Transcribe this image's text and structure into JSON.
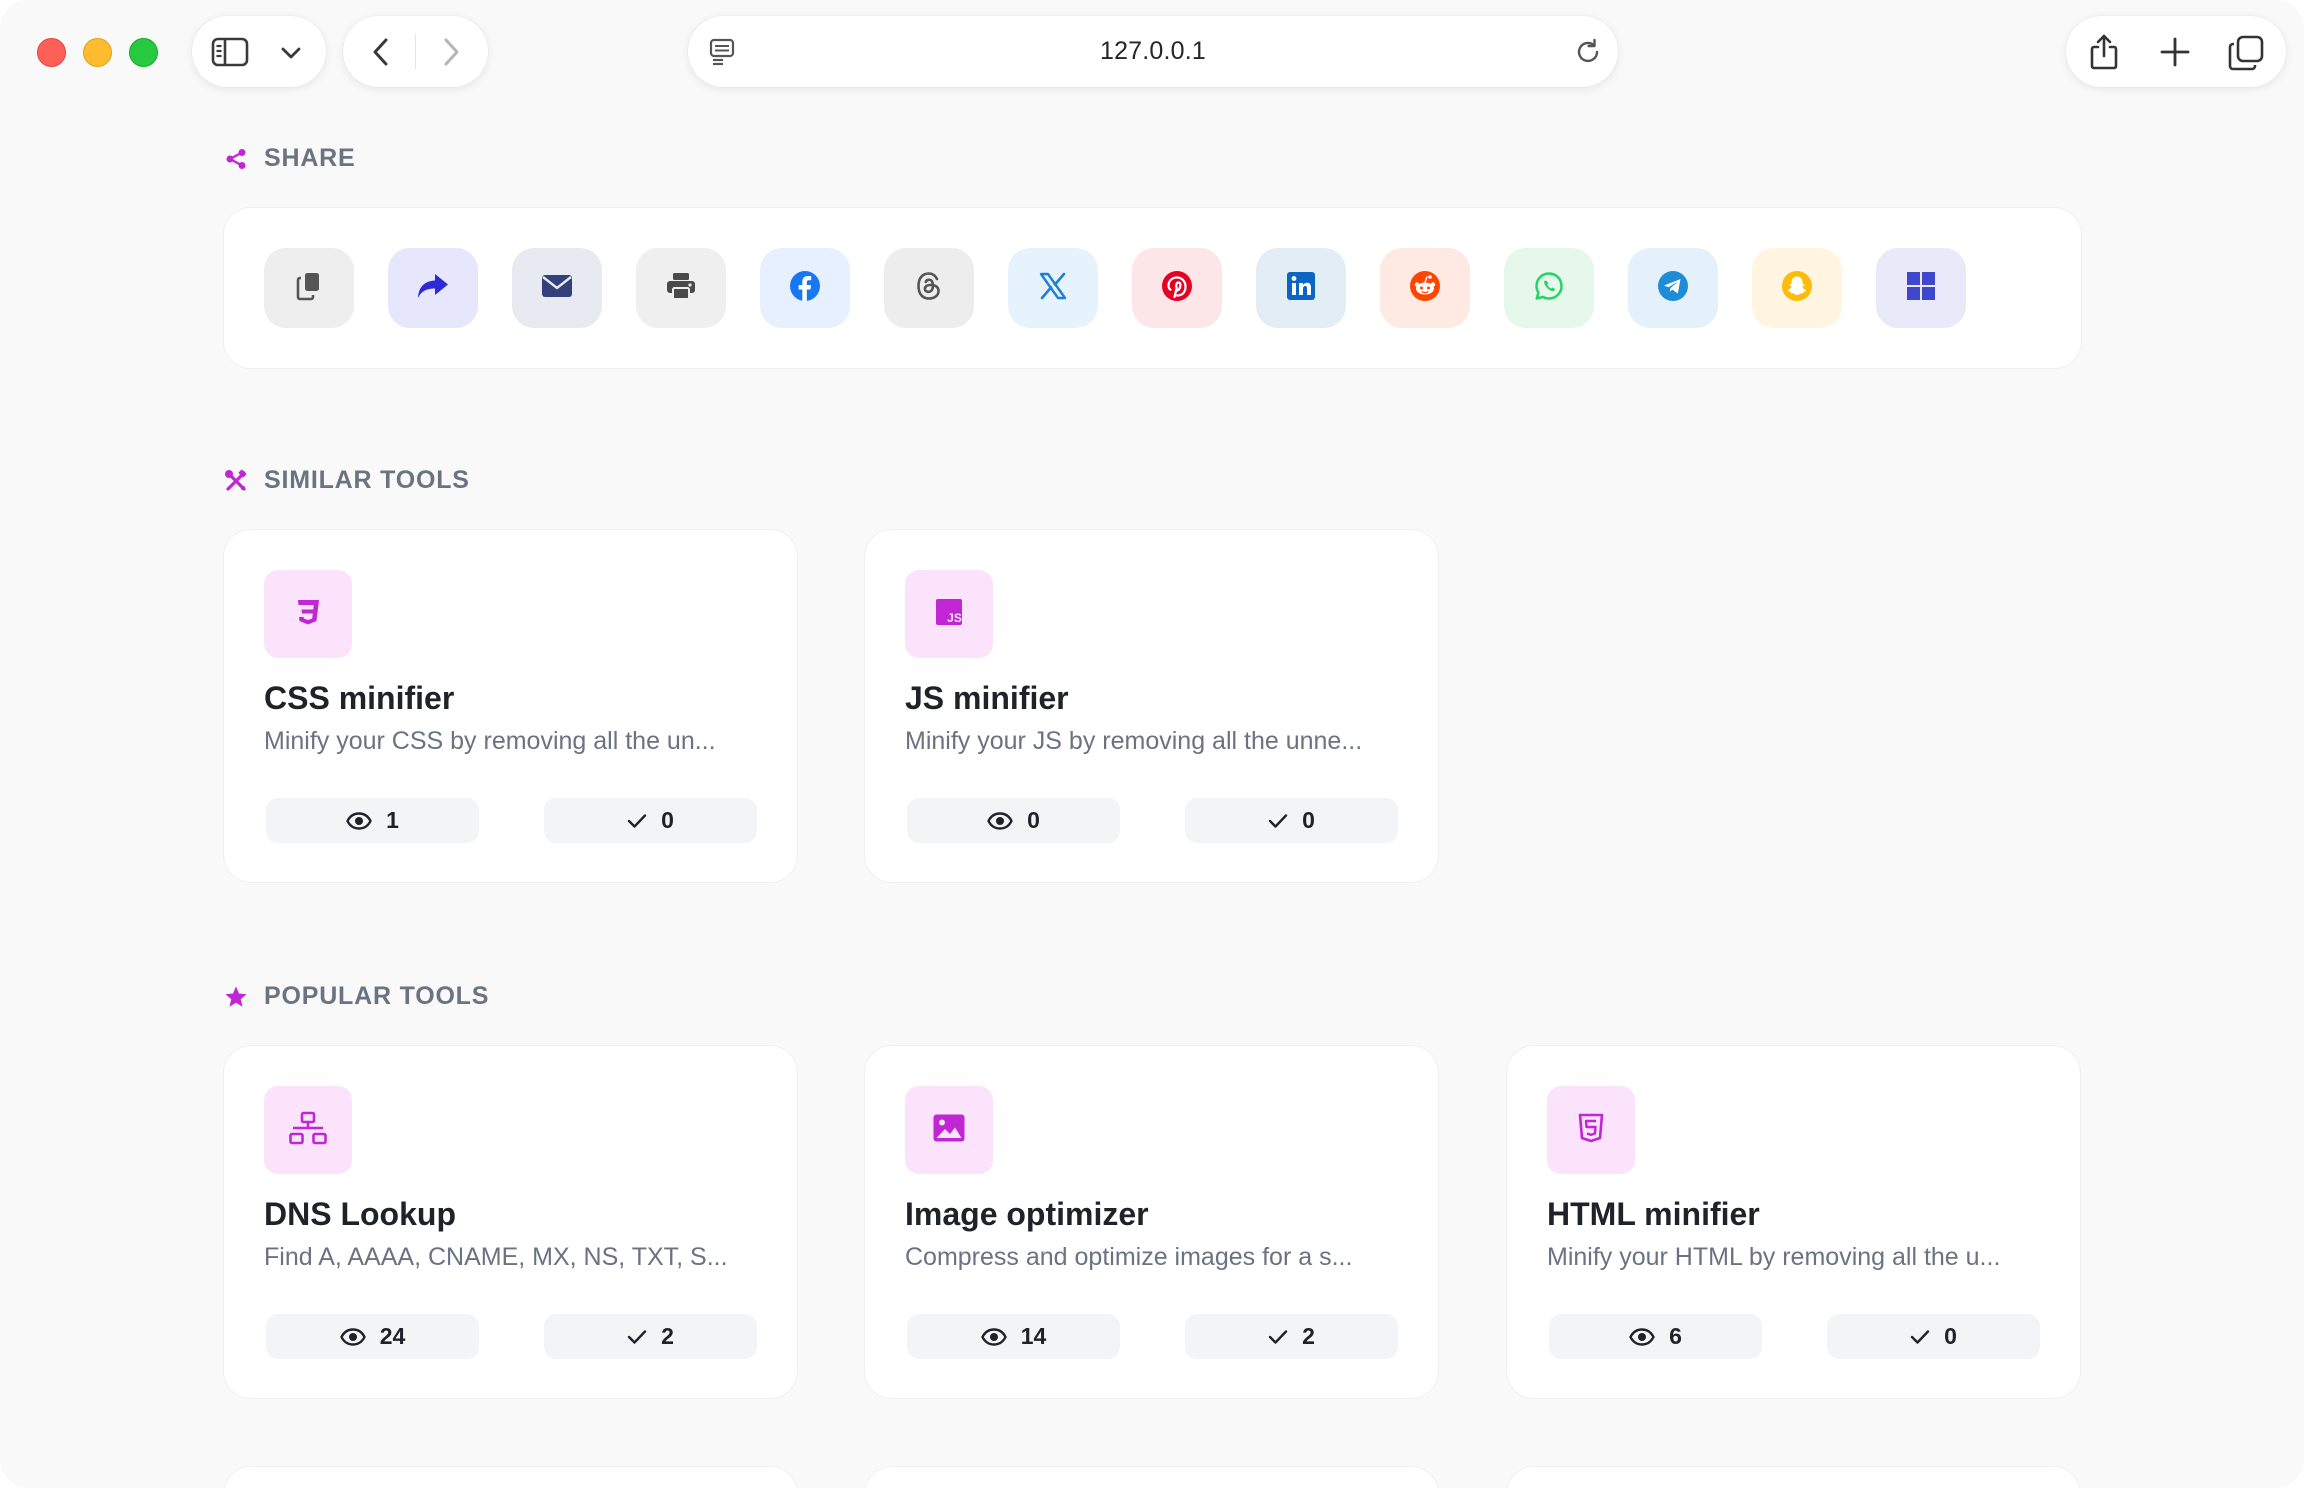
{
  "browser": {
    "url": "127.0.0.1"
  },
  "share": {
    "title": "SHARE",
    "buttons": [
      {
        "name": "copy-link",
        "icon": "copy-icon",
        "bg": "#eeeeef",
        "color": "#555555"
      },
      {
        "name": "native-share",
        "icon": "share-forward-icon",
        "bg": "#e6e7fd",
        "color": "#2b2ad6"
      },
      {
        "name": "email",
        "icon": "envelope-icon",
        "bg": "#e8eaf2",
        "color": "#33407a"
      },
      {
        "name": "print",
        "icon": "printer-icon",
        "bg": "#efeff0",
        "color": "#4a4a4a"
      },
      {
        "name": "facebook",
        "icon": "facebook-icon",
        "bg": "#e6f0fe",
        "color": "#1877f2"
      },
      {
        "name": "threads",
        "icon": "threads-icon",
        "bg": "#ededee",
        "color": "#555555"
      },
      {
        "name": "x",
        "icon": "x-icon",
        "bg": "#e6f3fd",
        "color": "#1d7fd6"
      },
      {
        "name": "pinterest",
        "icon": "pinterest-icon",
        "bg": "#fde6e8",
        "color": "#e60023"
      },
      {
        "name": "linkedin",
        "icon": "linkedin-icon",
        "bg": "#e3edf6",
        "color": "#0a66c2"
      },
      {
        "name": "reddit",
        "icon": "reddit-icon",
        "bg": "#feeae3",
        "color": "#ff4500"
      },
      {
        "name": "whatsapp",
        "icon": "whatsapp-icon",
        "bg": "#e6f8ec",
        "color": "#25d366"
      },
      {
        "name": "telegram",
        "icon": "telegram-icon",
        "bg": "#e4f1fb",
        "color": "#1f8dd6"
      },
      {
        "name": "snapchat",
        "icon": "snapchat-icon",
        "bg": "#fff5e1",
        "color": "#fcbc0c"
      },
      {
        "name": "microsoft",
        "icon": "windows-icon",
        "bg": "#e9e9fa",
        "color": "#3f48cc"
      }
    ]
  },
  "similar": {
    "title": "SIMILAR TOOLS",
    "tools": [
      {
        "title": "CSS minifier",
        "desc": "Minify your CSS by removing all the un...",
        "views": "1",
        "done": "0",
        "icon": "css3-icon"
      },
      {
        "title": "JS minifier",
        "desc": "Minify your JS by removing all the unne...",
        "views": "0",
        "done": "0",
        "icon": "js-icon"
      }
    ]
  },
  "popular": {
    "title": "POPULAR TOOLS",
    "tools": [
      {
        "title": "DNS Lookup",
        "desc": "Find A, AAAA, CNAME, MX, NS, TXT, S...",
        "views": "24",
        "done": "2",
        "icon": "network-icon"
      },
      {
        "title": "Image optimizer",
        "desc": "Compress and optimize images for a s...",
        "views": "14",
        "done": "2",
        "icon": "image-icon"
      },
      {
        "title": "HTML minifier",
        "desc": "Minify your HTML by removing all the u...",
        "views": "6",
        "done": "0",
        "icon": "html5-icon"
      }
    ]
  },
  "colors": {
    "accent": "#c026d3",
    "tool_icon_bg": "#fbe3fb"
  }
}
